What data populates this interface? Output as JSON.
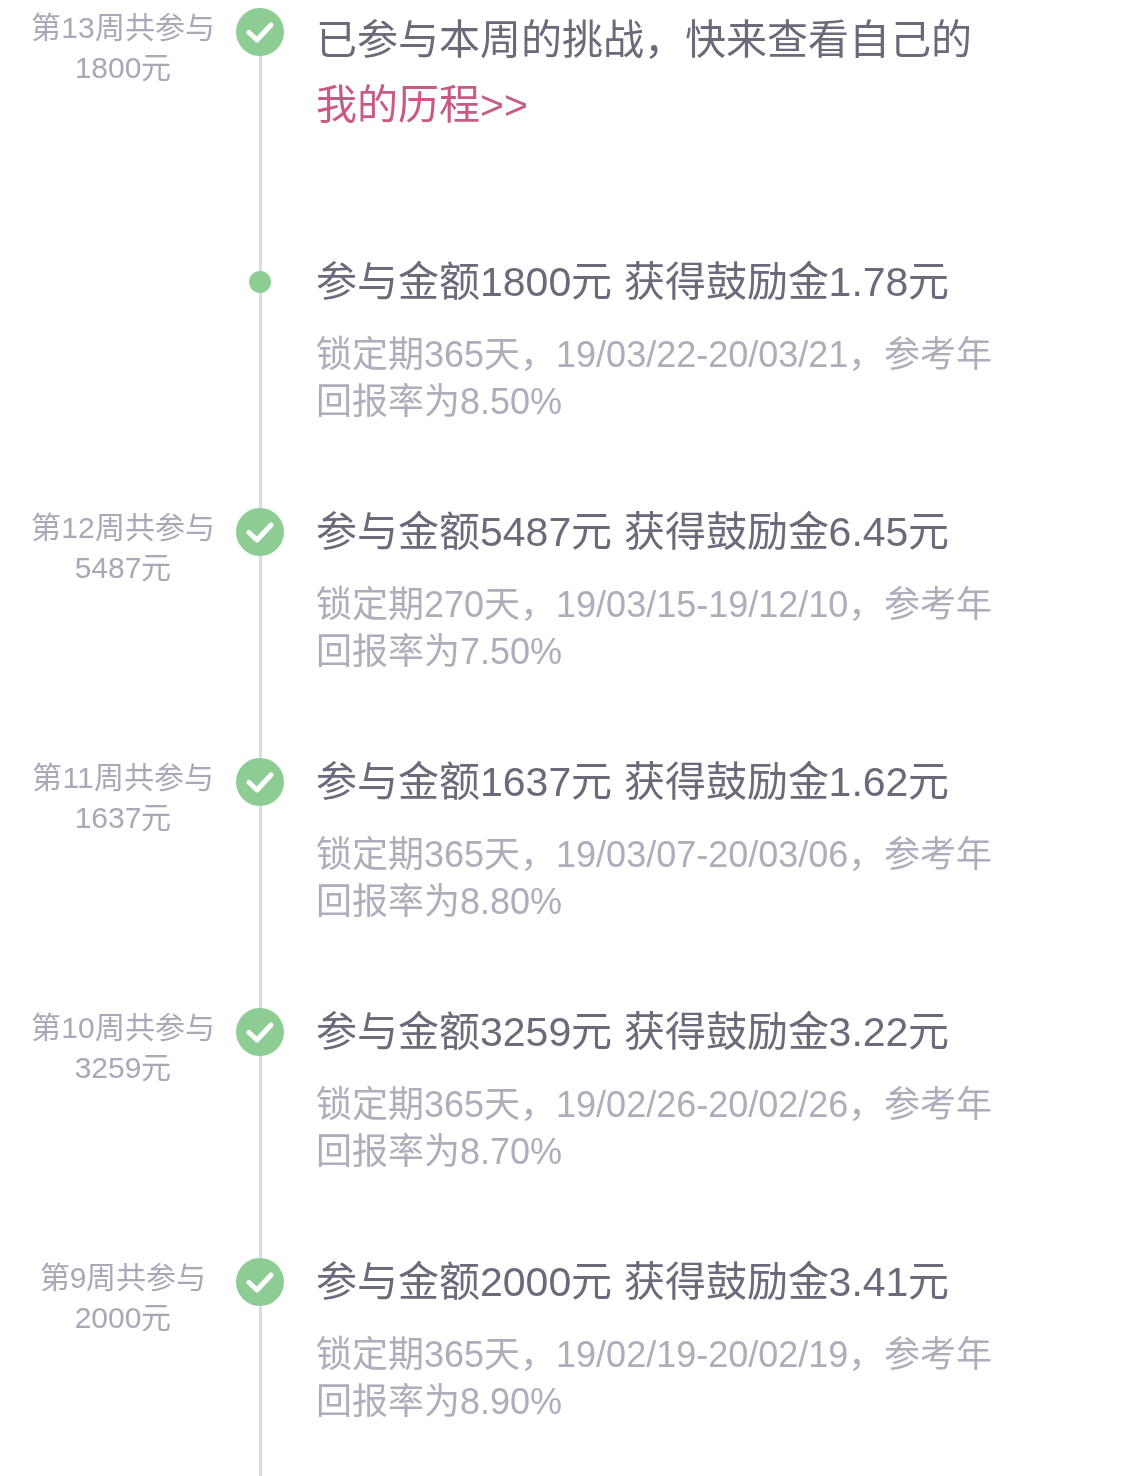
{
  "weeks": [
    {
      "week_label": "第13周共参与",
      "week_total": "1800元",
      "message": {
        "text": "已参与本周的挑战，快来查看自己的",
        "link": "我的历程>>"
      },
      "records": [
        {
          "title": "参与金额1800元 获得鼓励金1.78元",
          "detail": "锁定期365天，19/03/22-20/03/21，参考年回报率为8.50%"
        }
      ]
    },
    {
      "week_label": "第12周共参与",
      "week_total": "5487元",
      "records": [
        {
          "title": "参与金额5487元 获得鼓励金6.45元",
          "detail": "锁定期270天，19/03/15-19/12/10，参考年回报率为7.50%"
        }
      ]
    },
    {
      "week_label": "第11周共参与",
      "week_total": "1637元",
      "records": [
        {
          "title": "参与金额1637元 获得鼓励金1.62元",
          "detail": "锁定期365天，19/03/07-20/03/06，参考年回报率为8.80%"
        }
      ]
    },
    {
      "week_label": "第10周共参与",
      "week_total": "3259元",
      "records": [
        {
          "title": "参与金额3259元 获得鼓励金3.22元",
          "detail": "锁定期365天，19/02/26-20/02/26，参考年回报率为8.70%"
        }
      ]
    },
    {
      "week_label": "第9周共参与",
      "week_total": "2000元",
      "records": [
        {
          "title": "参与金额2000元 获得鼓励金3.41元",
          "detail": "锁定期365天，19/02/19-20/02/19，参考年回报率为8.90%"
        }
      ]
    }
  ]
}
